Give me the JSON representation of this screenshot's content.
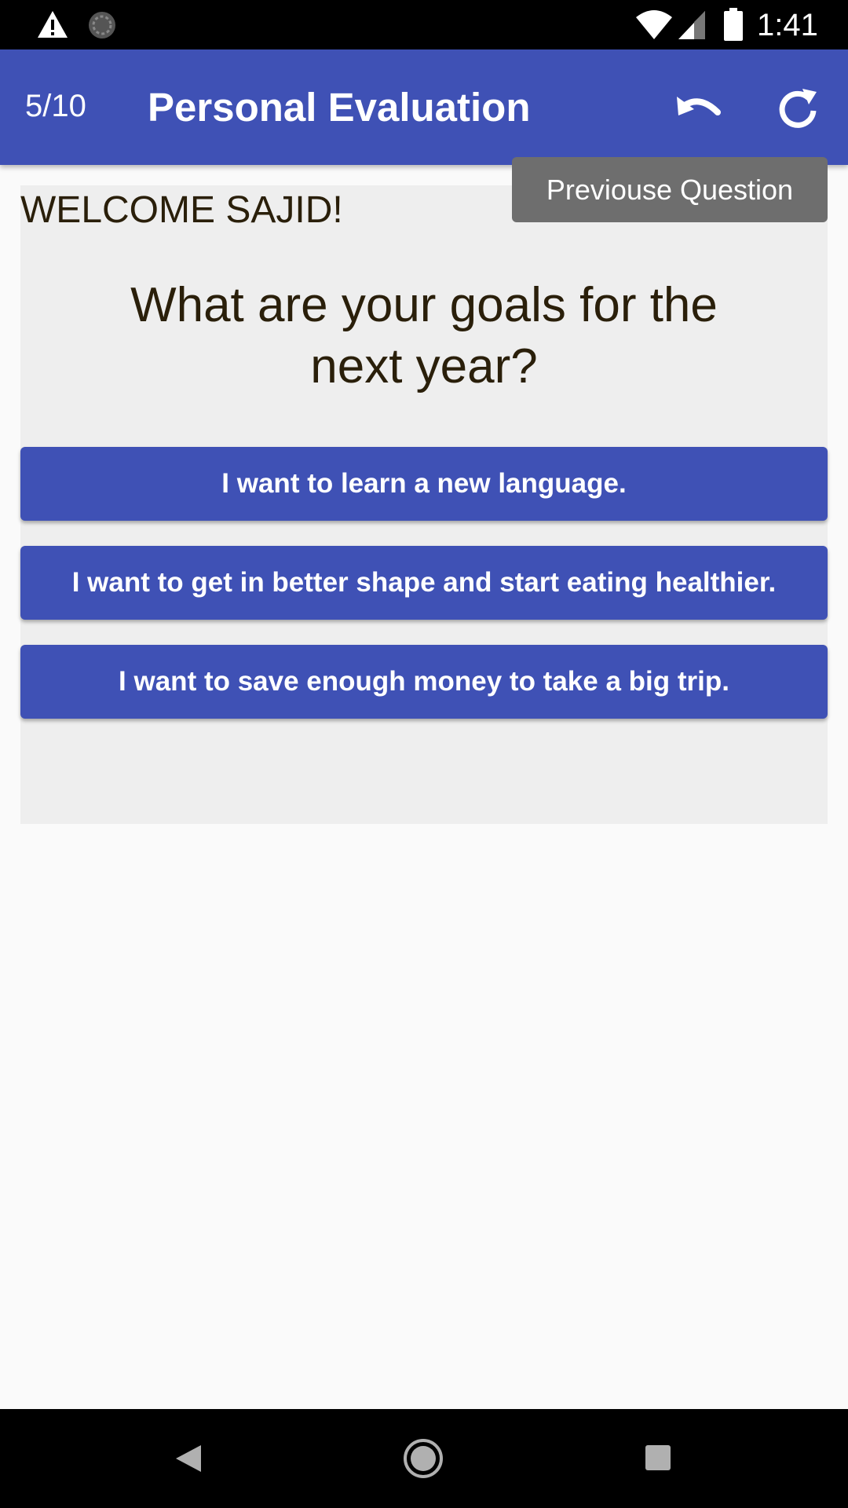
{
  "status_bar": {
    "time": "1:41",
    "icons": [
      "alert-icon",
      "sync-icon",
      "wifi-icon",
      "signal-icon",
      "battery-icon"
    ]
  },
  "app_bar": {
    "progress": "5/10",
    "title": "Personal Evaluation",
    "actions": [
      "undo-icon",
      "refresh-icon"
    ],
    "background_color": "#3f51b5"
  },
  "tooltip": {
    "text": "Previouse Question"
  },
  "content": {
    "welcome": "WELCOME SAJID!",
    "question": "What are your goals for the next year?",
    "answers": [
      "I want to learn a new language.",
      "I want to get in better shape and start eating healthier.",
      "I want to save enough money to take a big trip."
    ]
  },
  "nav_bar": {
    "buttons": [
      "back-icon",
      "home-icon",
      "recents-icon"
    ]
  }
}
